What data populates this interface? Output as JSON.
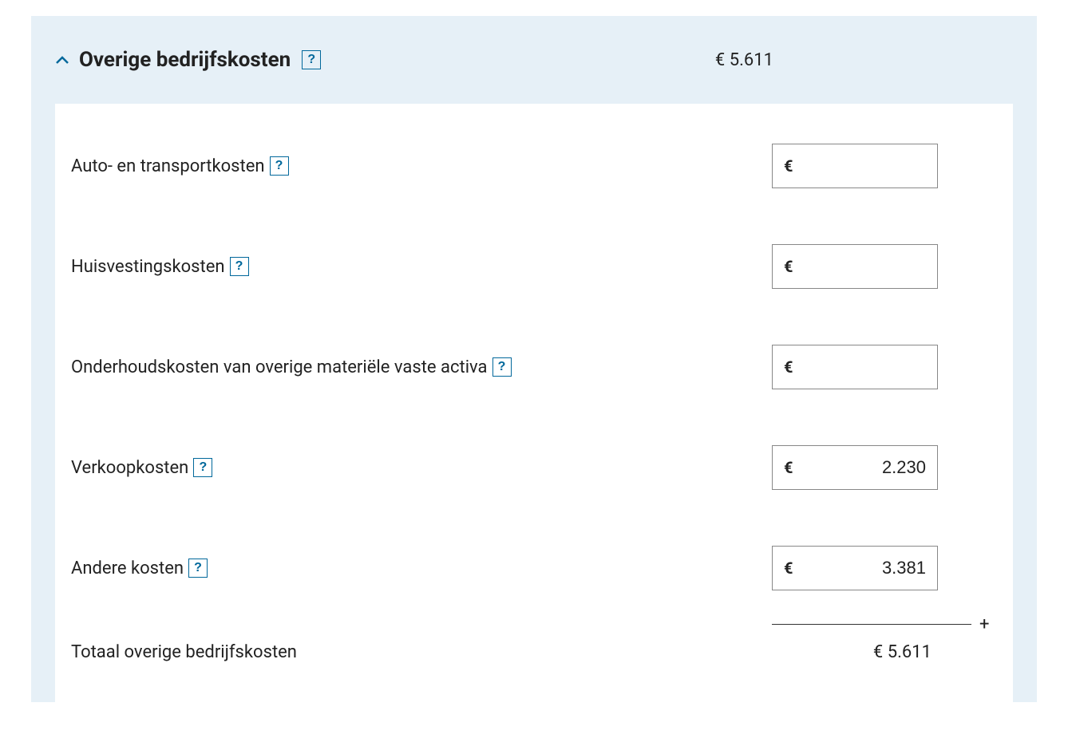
{
  "section": {
    "title": "Overige bedrijfskosten",
    "header_amount": "€ 5.611",
    "currency_symbol": "€",
    "plus_symbol": "+",
    "help_glyph": "?",
    "rows": [
      {
        "label": "Auto- en transportkosten",
        "value": ""
      },
      {
        "label": "Huisvestingskosten",
        "value": ""
      },
      {
        "label": "Onderhoudskosten van overige materiële vaste activa",
        "value": ""
      },
      {
        "label": "Verkoopkosten",
        "value": "2.230"
      },
      {
        "label": "Andere kosten",
        "value": "3.381"
      }
    ],
    "total_label": "Totaal overige bedrijfskosten",
    "total_amount": "€ 5.611"
  }
}
